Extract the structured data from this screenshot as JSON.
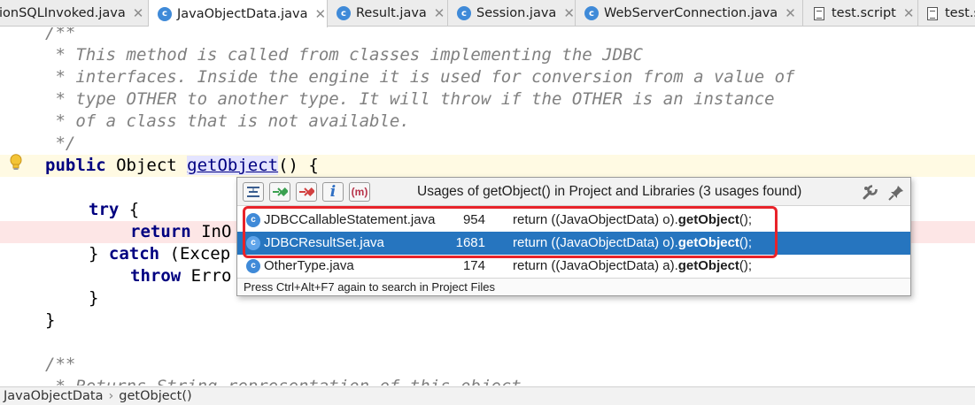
{
  "tabs": [
    {
      "label": "ionSQLInvoked.java",
      "icon": "class-icon",
      "active": false,
      "closable": true
    },
    {
      "label": "JavaObjectData.java",
      "icon": "class-icon",
      "active": true,
      "closable": true
    },
    {
      "label": "Result.java",
      "icon": "class-icon",
      "active": false,
      "closable": true
    },
    {
      "label": "Session.java",
      "icon": "class-icon",
      "active": false,
      "closable": true
    },
    {
      "label": "WebServerConnection.java",
      "icon": "class-icon",
      "active": false,
      "closable": true
    },
    {
      "label": "test.script",
      "icon": "file-icon",
      "active": false,
      "closable": true
    },
    {
      "label": "test.s",
      "icon": "file-icon",
      "active": false,
      "closable": false
    }
  ],
  "code": {
    "doc1_open": "/**",
    "doc1_line1": " * This method is called from classes implementing the JDBC",
    "doc1_line2": " * interfaces. Inside the engine it is used for conversion from a value of",
    "doc1_line3": " * type OTHER to another type. It will throw if the OTHER is an instance",
    "doc1_line4": " * of a class that is not available.",
    "doc1_close": " */",
    "sig_kw": "public",
    "sig_type": " Object ",
    "sig_method": "getObject",
    "sig_rest": "() {",
    "try_kw": "try",
    "try_rest": " {",
    "return_kw": "return",
    "return_rest": " InO",
    "close_brace": "}",
    "catch_kw": "catch",
    "catch_rest": " (Excep",
    "throw_kw": "throw",
    "throw_rest": " Erro",
    "doc2_open": "/**",
    "doc2_line1": " * Returns String representation of this object."
  },
  "popup": {
    "title": "Usages of getObject() in Project and Libraries (3 usages found)",
    "toolbar": [
      "merge-usages-icon",
      "next-occurrence-icon",
      "previous-occurrence-icon",
      "info-icon",
      "method-icon"
    ],
    "toolbar_glyphs": {
      "info": "i",
      "method": "m"
    },
    "header_icons": [
      "settings-wrench-icon",
      "pin-icon"
    ],
    "usages": [
      {
        "file": "JDBCCallableStatement.java",
        "line": "954",
        "code_prefix": "return ((JavaObjectData) o).",
        "code_match": "getObject",
        "code_suffix": "();",
        "selected": false,
        "highlighted": true
      },
      {
        "file": "JDBCResultSet.java",
        "line": "1681",
        "code_prefix": "return ((JavaObjectData) o).",
        "code_match": "getObject",
        "code_suffix": "();",
        "selected": true,
        "highlighted": true
      },
      {
        "file": "OtherType.java",
        "line": "174",
        "code_prefix": "return ((JavaObjectData) a).",
        "code_match": "getObject",
        "code_suffix": "();",
        "selected": false,
        "highlighted": false
      }
    ],
    "footer": "Press Ctrl+Alt+F7 again to search in Project Files"
  },
  "breadcrumb": [
    "JavaObjectData",
    "getObject()"
  ],
  "colors": {
    "selection": "#2675bf",
    "highlight_box": "#e8232a",
    "keyword": "#000080",
    "comment": "#808080",
    "class_icon": "#3f8ad8"
  },
  "class_icon_glyph": "c"
}
